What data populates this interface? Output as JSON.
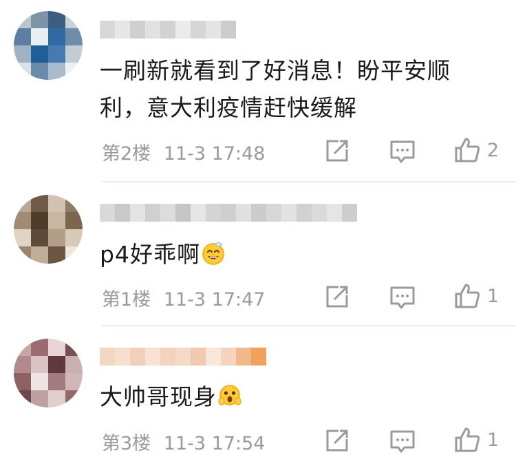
{
  "comments": [
    {
      "text_line1": "一刷新就看到了好消息！盼平安顺",
      "text_line2": "利，意大利疫情赶快缓解",
      "floor": "第2楼",
      "time": "11-3 17:48",
      "likes": "2",
      "avatar_colors": [
        "#b9c4cc",
        "#7d93a6",
        "#3d5e7e",
        "#c8d1d8",
        "#5c7ea0",
        "#e8eef2",
        "#2f6aa5",
        "#6f8da8",
        "#9fb3c3",
        "#1f5f99",
        "#457bb0",
        "#c2ccd4",
        "#d9e0e6",
        "#6b8bab",
        "#a8bccc",
        "#edf1f4"
      ],
      "username_colors": [
        "#d8d8d8",
        "#e6e6e6",
        "#cfcfcf",
        "#e1e1e1",
        "#d2d2d2",
        "#ebebeb",
        "#d6d6d6",
        "#e4e4e4",
        "#cccccc"
      ]
    },
    {
      "text_line1": "p4好乖啊",
      "floor": "第1楼",
      "time": "11-3 17:47",
      "likes": "1",
      "emoji": "grin-emoji",
      "avatar_colors": [
        "#b7a999",
        "#6e5a47",
        "#d2c2b1",
        "#8f7a63",
        "#a08b74",
        "#4e3c2b",
        "#c9b7a4",
        "#7b6650",
        "#e0d3c5",
        "#5d4a38",
        "#b39e87",
        "#d8cab9",
        "#9a866f",
        "#c2ae98",
        "#6a5642",
        "#efe6dc"
      ],
      "username_colors": [
        "#d9d9d9",
        "#c9c9c9",
        "#e3e3e3",
        "#d0d0d0",
        "#dcdcdc",
        "#c6c6c6",
        "#e6e6e6",
        "#d4d4d4",
        "#cfcfcf",
        "#e0e0e0",
        "#cccccc",
        "#d7d7d7",
        "#e2e2e2",
        "#d1d1d1",
        "#dadada",
        "#e5e5e5",
        "#cdcdcd"
      ]
    },
    {
      "text_line1": "大帅哥现身",
      "floor": "第3楼",
      "time": "11-3 17:54",
      "likes": "1",
      "emoji": "surprised-emoji",
      "avatar_colors": [
        "#c7a7a6",
        "#9b6b6f",
        "#e6d6d6",
        "#7a4e54",
        "#b08a8c",
        "#d9c3c4",
        "#5e3a40",
        "#c9b0b1",
        "#8f6166",
        "#efe4e4",
        "#a27b7e",
        "#d1b6b7",
        "#6d454b",
        "#bfa0a2",
        "#e1cfd0",
        "#94696d"
      ],
      "username_colors": [
        "#f4d6c2",
        "#f6dfcf",
        "#f2cfb8",
        "#f7e3d5",
        "#f3d3bd",
        "#f5dac8",
        "#f0c9af",
        "#f8e6da",
        "#f4d4bf",
        "#f0b98c",
        "#f2a05a"
      ]
    }
  ],
  "icons": {
    "share": "share-icon",
    "reply": "reply-icon",
    "like": "like-icon"
  }
}
